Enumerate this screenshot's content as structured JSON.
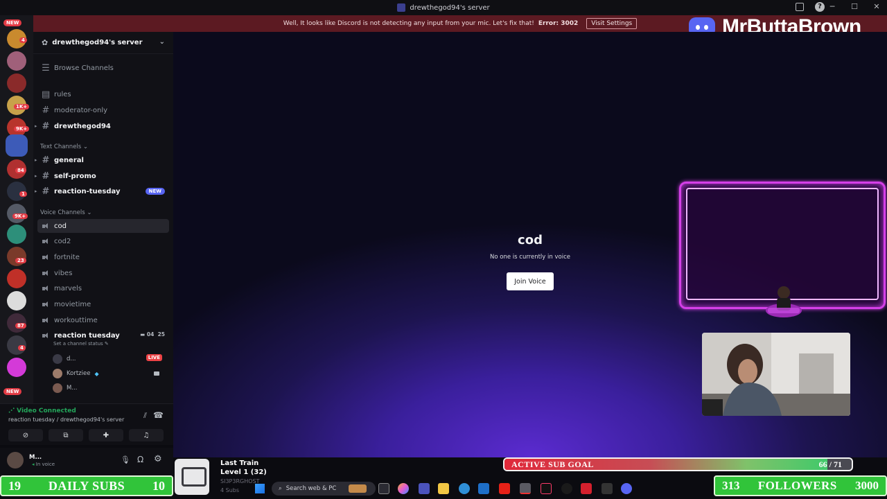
{
  "window": {
    "title": "drewthegod94's server"
  },
  "notice": {
    "message": "Well, It looks like Discord is not detecting any input from your mic. Let's fix that!",
    "error": "Error: 3002",
    "button": "Visit Settings"
  },
  "brand": {
    "name": "MrButtaBrown",
    "logo_icon": "discord-logo-icon"
  },
  "rail": {
    "badges": {
      "new_top": "NEW",
      "new_bottom": "NEW"
    },
    "counts": [
      "4",
      "1K+",
      "9K+",
      "84",
      "1",
      "9K+",
      "23",
      "87",
      "4"
    ]
  },
  "server": {
    "name": "drewthegod94's server",
    "browse": "Browse Channels"
  },
  "channels": {
    "top": [
      "rules",
      "moderator-only",
      "drewthegod94"
    ],
    "text_category": "Text Channels",
    "text": [
      "general",
      "self-promo",
      "reaction-tuesday"
    ],
    "new_badge": "NEW",
    "voice_category": "Voice Channels",
    "voice": [
      "cod",
      "cod2",
      "fortnite",
      "vibes",
      "marvels",
      "movietime",
      "workouttime"
    ],
    "active_voice": "reaction tuesday",
    "status_hint": "Set a channel status",
    "active_counts": {
      "video": "04",
      "users": "25"
    },
    "members": [
      {
        "name": "d...",
        "badge": "LIVE"
      },
      {
        "name": "Kortziee",
        "badge": ""
      },
      {
        "name": "M...",
        "badge": ""
      }
    ]
  },
  "voice_panel": {
    "status": "Video Connected",
    "location": "reaction tuesday / drewthegod94's server"
  },
  "user_panel": {
    "name": "M...",
    "status": "In voice"
  },
  "stage": {
    "channel": "cod",
    "subtitle": "No one is currently in voice",
    "join_label": "Join Voice"
  },
  "overlays": {
    "daily_subs": {
      "left": "19",
      "label": "DAILY SUBS",
      "right": "10"
    },
    "music": {
      "title": "Last Train",
      "level": "Level 1  (32)",
      "ghost1": "SI3P3RGHOST",
      "ghost2": "4 Subs"
    },
    "sub_goal": {
      "label": "ACTIVE SUB GOAL",
      "current": 66,
      "target": 71,
      "text": "66 / 71"
    },
    "followers": {
      "left": "313",
      "label": "FOLLOWERS",
      "right": "3000"
    }
  },
  "taskbar": {
    "search_placeholder": "Search web & PC"
  },
  "colors": {
    "accent": "#5865f2",
    "live": "#ed4245",
    "goal_green": "#31c43a",
    "neon": "#d53fe8"
  }
}
